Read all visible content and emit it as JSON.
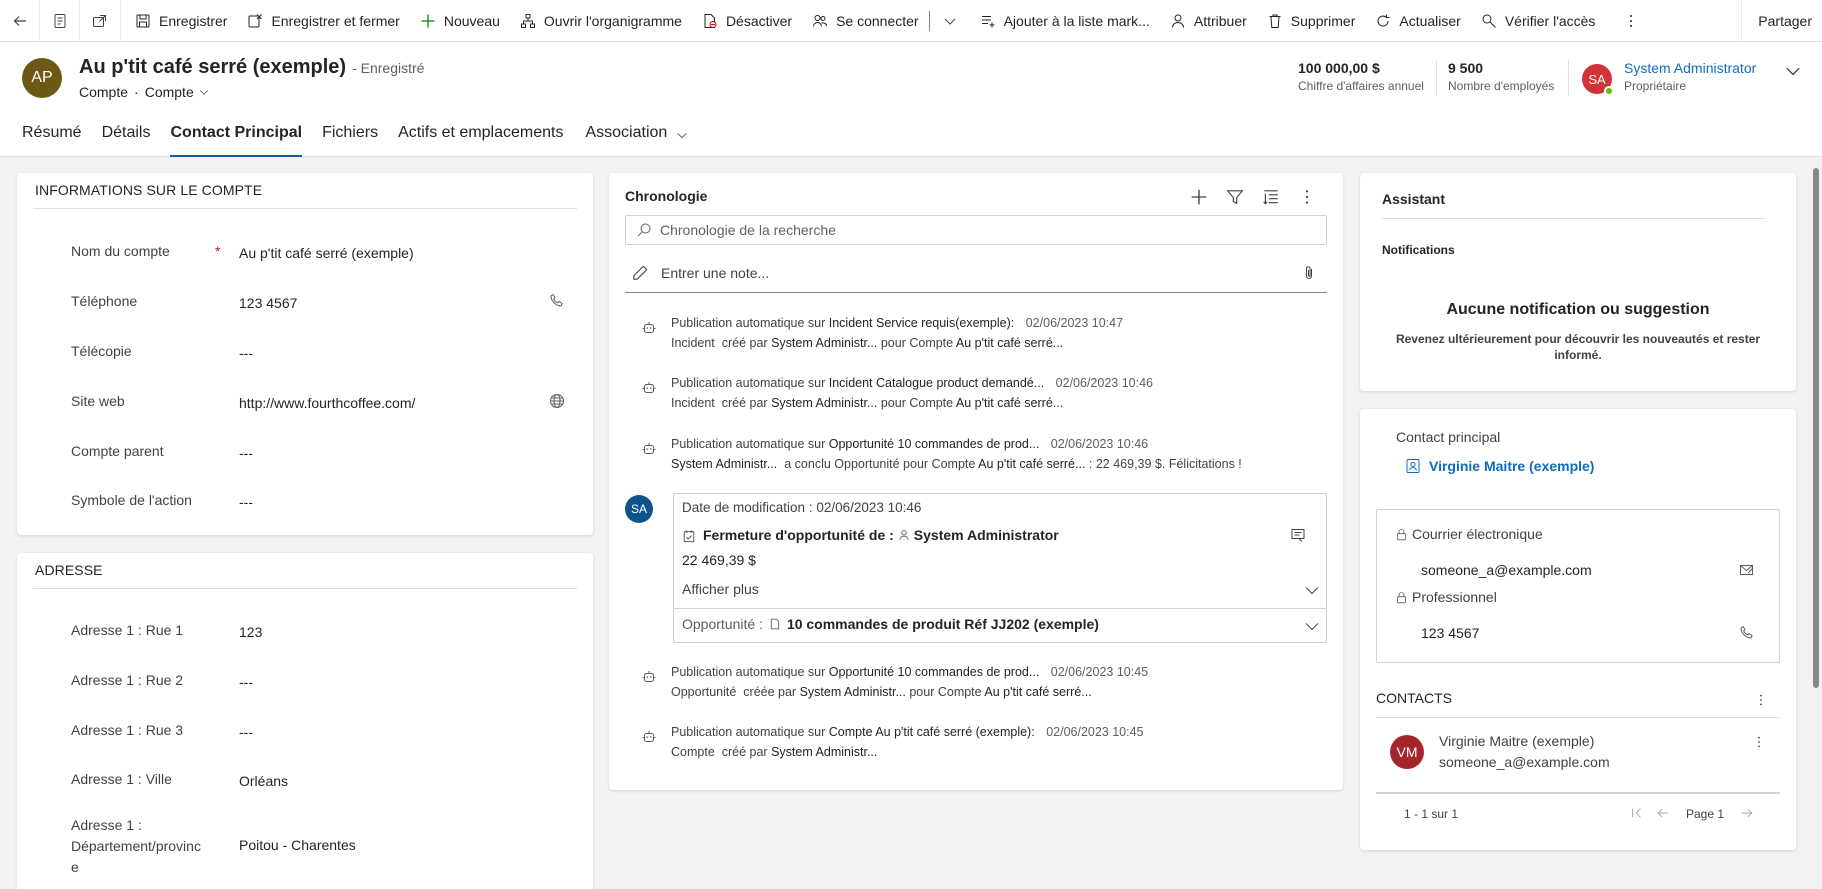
{
  "command_bar": {
    "save": "Enregistrer",
    "save_close": "Enregistrer et fermer",
    "new": "Nouveau",
    "org_chart": "Ouvrir l'organigramme",
    "deactivate": "Désactiver",
    "connect": "Se connecter",
    "add_marketing_list": "Ajouter à la liste mark...",
    "assign": "Attribuer",
    "delete": "Supprimer",
    "refresh": "Actualiser",
    "check_access": "Vérifier l'accès",
    "share": "Partager"
  },
  "header": {
    "avatar_initials": "AP",
    "record_name": "Au p'tit café serré (exemple)",
    "save_status": "- Enregistré",
    "entity": "Compte",
    "form": "Compte",
    "kpis": [
      {
        "value": "100 000,00 $",
        "label": "Chiffre d'affaires annuel"
      },
      {
        "value": "9 500",
        "label": "Nombre d'employés"
      }
    ],
    "owner": {
      "initials": "SA",
      "name": "System Administrator",
      "role": "Propriétaire"
    }
  },
  "tabs": [
    "Résumé",
    "Détails",
    "Contact Principal",
    "Fichiers",
    "Actifs et emplacements",
    "Association"
  ],
  "account_info": {
    "title": "INFORMATIONS SUR LE COMPTE",
    "fields": [
      {
        "label": "Nom du compte",
        "value": "Au p'tit café serré (exemple)"
      },
      {
        "label": "Téléphone",
        "value": "123 4567"
      },
      {
        "label": "Télécopie",
        "value": "---"
      },
      {
        "label": "Site web",
        "value": "http://www.fourthcoffee.com/"
      },
      {
        "label": "Compte parent",
        "value": "---"
      },
      {
        "label": "Symbole de l'action",
        "value": "---"
      }
    ]
  },
  "address": {
    "title": "ADRESSE",
    "fields": [
      {
        "label": "Adresse 1 : Rue 1",
        "value": "123"
      },
      {
        "label": "Adresse 1 : Rue 2",
        "value": "---"
      },
      {
        "label": "Adresse 1 : Rue 3",
        "value": "---"
      },
      {
        "label": "Adresse 1 : Ville",
        "value": "Orléans"
      },
      {
        "label_lines": [
          "Adresse 1 :",
          "Département/provinc",
          "e"
        ],
        "value": "Poitou - Charentes"
      }
    ]
  },
  "timeline": {
    "title": "Chronologie",
    "search_placeholder": "Chronologie de la recherche",
    "note_placeholder": "Entrer une note...",
    "posts": [
      {
        "prefix": "Publication automatique sur",
        "subject": "Incident Service requis(exemple):",
        "date": "02/06/2023 10:47",
        "l2_a": "Incident",
        "l2_b": "créé par",
        "l2_user": "System Administr...",
        "l2_c": "pour Compte",
        "l2_account": "Au p'tit café serré..."
      },
      {
        "prefix": "Publication automatique sur",
        "subject": "Incident Catalogue product demandé...",
        "date": "02/06/2023 10:46",
        "l2_a": "Incident",
        "l2_b": "créé par",
        "l2_user": "System Administr...",
        "l2_c": "pour Compte",
        "l2_account": "Au p'tit café serré..."
      },
      {
        "prefix": "Publication automatique sur",
        "subject": "Opportunité 10 commandes de prod...",
        "date": "02/06/2023 10:46",
        "l2_user": "System Administr...",
        "l2_c": "a conclu Opportunité pour Compte",
        "l2_account": "Au p'tit café serré...",
        "l2_d": ": 22 469,39 $. Félicitations !"
      }
    ],
    "expanded": {
      "initials": "SA",
      "modified": "Date de modification : 02/06/2023 10:46",
      "title_prefix": "Fermeture d'opportunité de :",
      "title_user": "System Administrator",
      "amount": "22 469,39 $",
      "show_more": "Afficher plus",
      "opp_label": "Opportunité :",
      "opp_name": "10 commandes de produit Réf JJ202 (exemple)"
    },
    "posts2": [
      {
        "prefix": "Publication automatique sur",
        "subject": "Opportunité 10 commandes de prod...",
        "date": "02/06/2023 10:45",
        "l2_a": "Opportunité",
        "l2_b": "créée par",
        "l2_user": "System Administr...",
        "l2_c": "pour Compte",
        "l2_account": "Au p'tit café serré..."
      },
      {
        "prefix": "Publication automatique sur",
        "subject": "Compte Au p'tit café serré (exemple):",
        "date": "02/06/2023 10:45",
        "l2_a": "Compte",
        "l2_b": "créé par",
        "l2_user": "System Administr..."
      }
    ]
  },
  "assistant": {
    "title": "Assistant",
    "sub": "Notifications",
    "empty_title": "Aucune notification ou suggestion",
    "empty_text_1": "Revenez ultérieurement pour découvrir les nouveautés et rester",
    "empty_text_2": "informé."
  },
  "primary_contact": {
    "label": "Contact principal",
    "name": "Virginie Maitre (exemple)",
    "email_label": "Courrier électronique",
    "email": "someone_a@example.com",
    "phone_label": "Professionnel",
    "phone": "123 4567"
  },
  "contacts": {
    "title": "CONTACTS",
    "items": [
      {
        "initials": "VM",
        "name": "Virginie Maitre (exemple)",
        "email": "someone_a@example.com"
      }
    ],
    "range": "1 - 1 sur 1",
    "page": "Page 1"
  },
  "colors": {
    "brand": "#115ea3",
    "link": "#0f6cbd",
    "required": "#c50f1f",
    "avatar_ap": "#6b5915",
    "avatar_sa": "#d13438",
    "avatar_timeline": "#0f548c",
    "avatar_vm": "#a4262c"
  }
}
